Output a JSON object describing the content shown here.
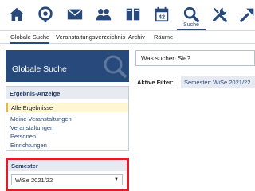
{
  "nav": {
    "icons": [
      "home-icon",
      "activity-icon",
      "mail-icon",
      "community-icon",
      "files-icon",
      "calendar-icon",
      "search-icon",
      "tools-icon",
      "admin-icon"
    ],
    "calendar_day": "42",
    "active_label": "Suche"
  },
  "subnav": {
    "items": [
      "Globale Suche",
      "Veranstaltungsverzeichnis",
      "Archiv",
      "Räume"
    ]
  },
  "sidebar": {
    "header_title": "Globale Suche",
    "results": {
      "title": "Ergebnis-Anzeige",
      "selected": "Alle Ergebnisse",
      "items": [
        "Meine Veranstaltungen",
        "Veranstaltungen",
        "Personen",
        "Einrichtungen"
      ]
    },
    "semester": {
      "title": "Semester",
      "selected": "WiSe 2021/22"
    }
  },
  "main": {
    "search_placeholder": "Was suchen Sie?",
    "filter_label": "Aktive Filter:",
    "filter_chip": "Semester: WiSe 2021/22"
  },
  "colors": {
    "brand": "#28497c",
    "highlight": "#d9202a",
    "selected_bg": "#fff6d6"
  }
}
